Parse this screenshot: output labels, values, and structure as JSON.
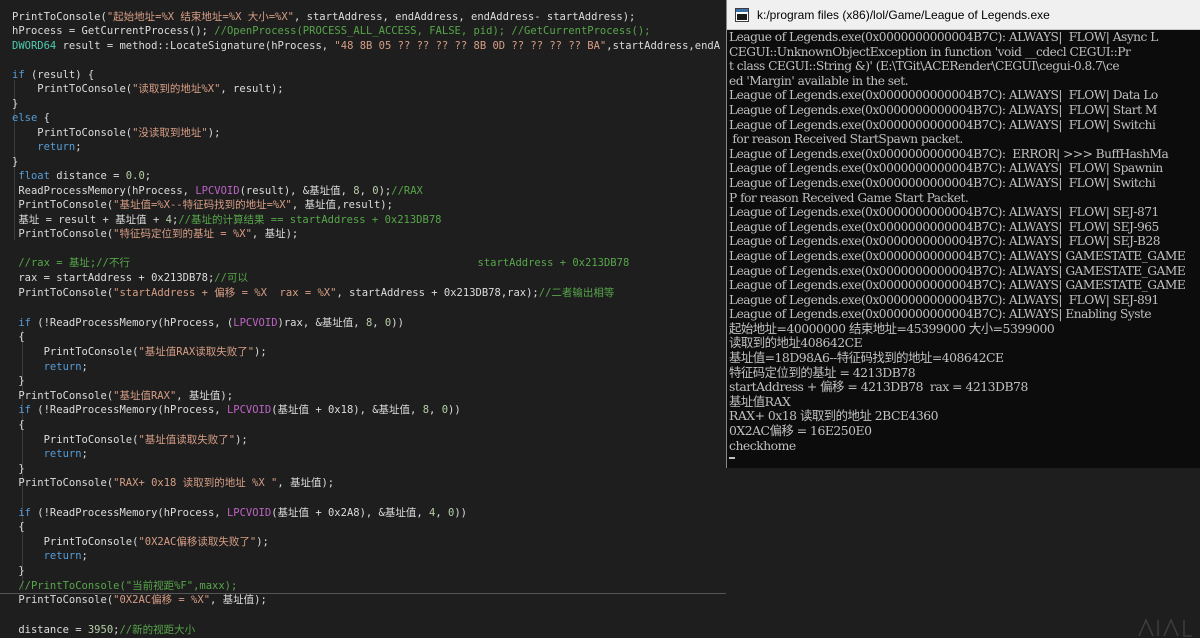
{
  "colors": {
    "editor_bg": "#1e1e1e",
    "text": "#dcdcdc",
    "string": "#d69d85",
    "comment": "#57a64a",
    "keyword": "#569cd6",
    "type": "#4ec9b0",
    "macro": "#bd63c5",
    "number": "#b5cea8",
    "variable": "#9cdcfe",
    "console_bg": "#0c0c0c",
    "console_text": "#c0c0c0"
  },
  "editor": {
    "lines": [
      {
        "tokens": [
          [
            "t",
            "PrintToConsole("
          ],
          [
            "s",
            "\"起始地址=%X 结束地址=%X 大小=%X\""
          ],
          [
            "t",
            ", startAddress, endAddress, endAddress- startAddress);"
          ]
        ]
      },
      {
        "tokens": [
          [
            "t",
            "hProcess = GetCurrentProcess(); "
          ],
          [
            "c",
            "//OpenProcess(PROCESS_ALL_ACCESS, FALSE, pid); //GetCurrentProcess();"
          ]
        ]
      },
      {
        "tokens": [
          [
            "ty",
            "DWORD64"
          ],
          [
            "t",
            " result = method::LocateSignature(hProcess, "
          ],
          [
            "s",
            "\"48 8B 05 ?? ?? ?? ?? 8B 0D ?? ?? ?? ?? BA\""
          ],
          [
            "t",
            ",startAddress,endA"
          ]
        ]
      },
      {
        "tokens": []
      },
      {
        "tokens": [
          [
            "k",
            "if"
          ],
          [
            "t",
            " (result) {"
          ]
        ]
      },
      {
        "tokens": [
          [
            "t",
            "    PrintToConsole("
          ],
          [
            "s",
            "\"读取到的地址%X\""
          ],
          [
            "t",
            ", result);"
          ]
        ]
      },
      {
        "tokens": [
          [
            "t",
            "}"
          ]
        ]
      },
      {
        "tokens": [
          [
            "k",
            "else"
          ],
          [
            "t",
            " {"
          ]
        ]
      },
      {
        "tokens": [
          [
            "t",
            "    PrintToConsole("
          ],
          [
            "s",
            "\"没读取到地址\""
          ],
          [
            "t",
            ");"
          ]
        ]
      },
      {
        "tokens": [
          [
            "k",
            "    return"
          ],
          [
            "t",
            ";"
          ]
        ]
      },
      {
        "tokens": [
          [
            "t",
            "}"
          ]
        ]
      },
      {
        "tokens": [
          [
            "k",
            " float"
          ],
          [
            "t",
            " distance = "
          ],
          [
            "n",
            "0.0"
          ],
          [
            "t",
            ";"
          ]
        ]
      },
      {
        "tokens": [
          [
            "t",
            " ReadProcessMemory(hProcess, "
          ],
          [
            "m",
            "LPCVOID"
          ],
          [
            "t",
            "(result), &基址值, "
          ],
          [
            "n",
            "8"
          ],
          [
            "t",
            ", "
          ],
          [
            "n",
            "0"
          ],
          [
            "t",
            ");"
          ],
          [
            "c",
            "//RAX"
          ]
        ]
      },
      {
        "tokens": [
          [
            "t",
            " PrintToConsole("
          ],
          [
            "s",
            "\"基址值=%X--特征码找到的地址=%X\""
          ],
          [
            "t",
            ", 基址值,result);"
          ]
        ]
      },
      {
        "tokens": [
          [
            "t",
            " 基址 = result + 基址值 + "
          ],
          [
            "n",
            "4"
          ],
          [
            "t",
            ";"
          ],
          [
            "c",
            "//基址的计算结果 == startAddress + 0x213DB78"
          ]
        ]
      },
      {
        "tokens": [
          [
            "t",
            " PrintToConsole("
          ],
          [
            "s",
            "\"特征码定位到的基址 = %X\""
          ],
          [
            "t",
            ", 基址);"
          ]
        ]
      },
      {
        "tokens": []
      },
      {
        "tokens": [
          [
            "c",
            " //rax = 基址;//不行                                                       startAddress + 0x213DB78"
          ]
        ]
      },
      {
        "tokens": [
          [
            "t",
            " rax = startAddress + 0x213DB78;"
          ],
          [
            "c",
            "//可以"
          ]
        ]
      },
      {
        "tokens": [
          [
            "t",
            " PrintToConsole("
          ],
          [
            "s",
            "\"startAddress + 偏移 = %X  rax = %X\""
          ],
          [
            "t",
            ", startAddress + 0x213DB78,rax);"
          ],
          [
            "c",
            "//二者输出相等"
          ]
        ]
      },
      {
        "tokens": []
      },
      {
        "tokens": [
          [
            "k",
            " if"
          ],
          [
            "t",
            " (!ReadProcessMemory(hProcess, ("
          ],
          [
            "m",
            "LPCVOID"
          ],
          [
            "t",
            ")rax, &基址值, "
          ],
          [
            "n",
            "8"
          ],
          [
            "t",
            ", "
          ],
          [
            "n",
            "0"
          ],
          [
            "t",
            "))"
          ]
        ]
      },
      {
        "tokens": [
          [
            "t",
            " {"
          ]
        ]
      },
      {
        "tokens": [
          [
            "t",
            "     PrintToConsole("
          ],
          [
            "s",
            "\"基址值RAX读取失败了\""
          ],
          [
            "t",
            ");"
          ]
        ]
      },
      {
        "tokens": [
          [
            "k",
            "     return"
          ],
          [
            "t",
            ";"
          ]
        ]
      },
      {
        "tokens": [
          [
            "t",
            " }"
          ]
        ]
      },
      {
        "tokens": [
          [
            "t",
            " PrintToConsole("
          ],
          [
            "s",
            "\"基址值RAX\""
          ],
          [
            "t",
            ", 基址值);"
          ]
        ]
      },
      {
        "tokens": [
          [
            "k",
            " if"
          ],
          [
            "t",
            " (!ReadProcessMemory(hProcess, "
          ],
          [
            "m",
            "LPCVOID"
          ],
          [
            "t",
            "(基址值 + 0x18), &基址值, "
          ],
          [
            "n",
            "8"
          ],
          [
            "t",
            ", "
          ],
          [
            "n",
            "0"
          ],
          [
            "t",
            "))"
          ]
        ]
      },
      {
        "tokens": [
          [
            "t",
            " {"
          ]
        ]
      },
      {
        "tokens": [
          [
            "t",
            "     PrintToConsole("
          ],
          [
            "s",
            "\"基址值读取失败了\""
          ],
          [
            "t",
            ");"
          ]
        ]
      },
      {
        "tokens": [
          [
            "k",
            "     return"
          ],
          [
            "t",
            ";"
          ]
        ]
      },
      {
        "tokens": [
          [
            "t",
            " }"
          ]
        ]
      },
      {
        "tokens": [
          [
            "t",
            " PrintToConsole("
          ],
          [
            "s",
            "\"RAX+ 0x18 读取到的地址 %X \""
          ],
          [
            "t",
            ", 基址值);"
          ]
        ]
      },
      {
        "tokens": []
      },
      {
        "tokens": [
          [
            "k",
            " if"
          ],
          [
            "t",
            " (!ReadProcessMemory(hProcess, "
          ],
          [
            "m",
            "LPCVOID"
          ],
          [
            "t",
            "(基址值 + 0x2A8), &基址值, "
          ],
          [
            "n",
            "4"
          ],
          [
            "t",
            ", "
          ],
          [
            "n",
            "0"
          ],
          [
            "t",
            "))"
          ]
        ]
      },
      {
        "tokens": [
          [
            "t",
            " {"
          ]
        ]
      },
      {
        "tokens": [
          [
            "t",
            "     PrintToConsole("
          ],
          [
            "s",
            "\"0X2AC偏移读取失败了\""
          ],
          [
            "t",
            ");"
          ]
        ]
      },
      {
        "tokens": [
          [
            "k",
            "     return"
          ],
          [
            "t",
            ";"
          ]
        ]
      },
      {
        "tokens": [
          [
            "t",
            " }"
          ]
        ]
      },
      {
        "tokens": [
          [
            "c",
            " //PrintToConsole(\"当前视距%F\",maxx);"
          ]
        ]
      },
      {
        "tokens": [
          [
            "t",
            " PrintToConsole("
          ],
          [
            "s",
            "\"0X2AC偏移 = %X\""
          ],
          [
            "t",
            ", 基址值);"
          ]
        ]
      },
      {
        "tokens": []
      },
      {
        "tokens": [
          [
            "t",
            " distance = "
          ],
          [
            "n",
            "3950"
          ],
          [
            "t",
            ";"
          ],
          [
            "c",
            "//新的视距大小"
          ]
        ]
      }
    ]
  },
  "console": {
    "title": "k:/program files (x86)/lol/Game/League of Legends.exe",
    "log_lines": [
      "League of Legends.exe(0x0000000000004B7C): ALWAYS|  FLOW| Async L",
      "CEGUI::UnknownObjectException in function 'void __cdecl CEGUI::Pr",
      "t class CEGUI::String &)' (E:\\TGit\\ACERender\\CEGUI\\cegui-0.8.7\\ce",
      "ed 'Margin' available in the set.",
      "League of Legends.exe(0x0000000000004B7C): ALWAYS|  FLOW| Data Lo",
      "League of Legends.exe(0x0000000000004B7C): ALWAYS|  FLOW| Start M",
      "League of Legends.exe(0x0000000000004B7C): ALWAYS|  FLOW| Switchi",
      " for reason Received StartSpawn packet.",
      "League of Legends.exe(0x0000000000004B7C):  ERROR| >>> BuffHashMa",
      "League of Legends.exe(0x0000000000004B7C): ALWAYS|  FLOW| Spawnin",
      "League of Legends.exe(0x0000000000004B7C): ALWAYS|  FLOW| Switchi",
      "P for reason Received Game Start Packet.",
      "League of Legends.exe(0x0000000000004B7C): ALWAYS|  FLOW| SEJ-871",
      "League of Legends.exe(0x0000000000004B7C): ALWAYS|  FLOW| SEJ-965",
      "League of Legends.exe(0x0000000000004B7C): ALWAYS|  FLOW| SEJ-B28",
      "League of Legends.exe(0x0000000000004B7C): ALWAYS| GAMESTATE_GAME",
      "League of Legends.exe(0x0000000000004B7C): ALWAYS| GAMESTATE_GAME",
      "League of Legends.exe(0x0000000000004B7C): ALWAYS| GAMESTATE_GAME",
      "League of Legends.exe(0x0000000000004B7C): ALWAYS|  FLOW| SEJ-891",
      "League of Legends.exe(0x0000000000004B7C): ALWAYS| Enabling Syste"
    ],
    "output_lines": [
      "起始地址=40000000 结束地址=45399000 大小=5399000",
      "读取到的地址408642CE",
      "基址值=18D98A6--特征码找到的地址=408642CE",
      "特征码定位到的基址 = 4213DB78",
      "startAddress + 偏移 = 4213DB78  rax = 4213DB78",
      "基址值RAX",
      "RAX+ 0x18 读取到的地址 2BCE4360",
      "0X2AC偏移 = 16E250E0",
      "checkhome"
    ]
  }
}
